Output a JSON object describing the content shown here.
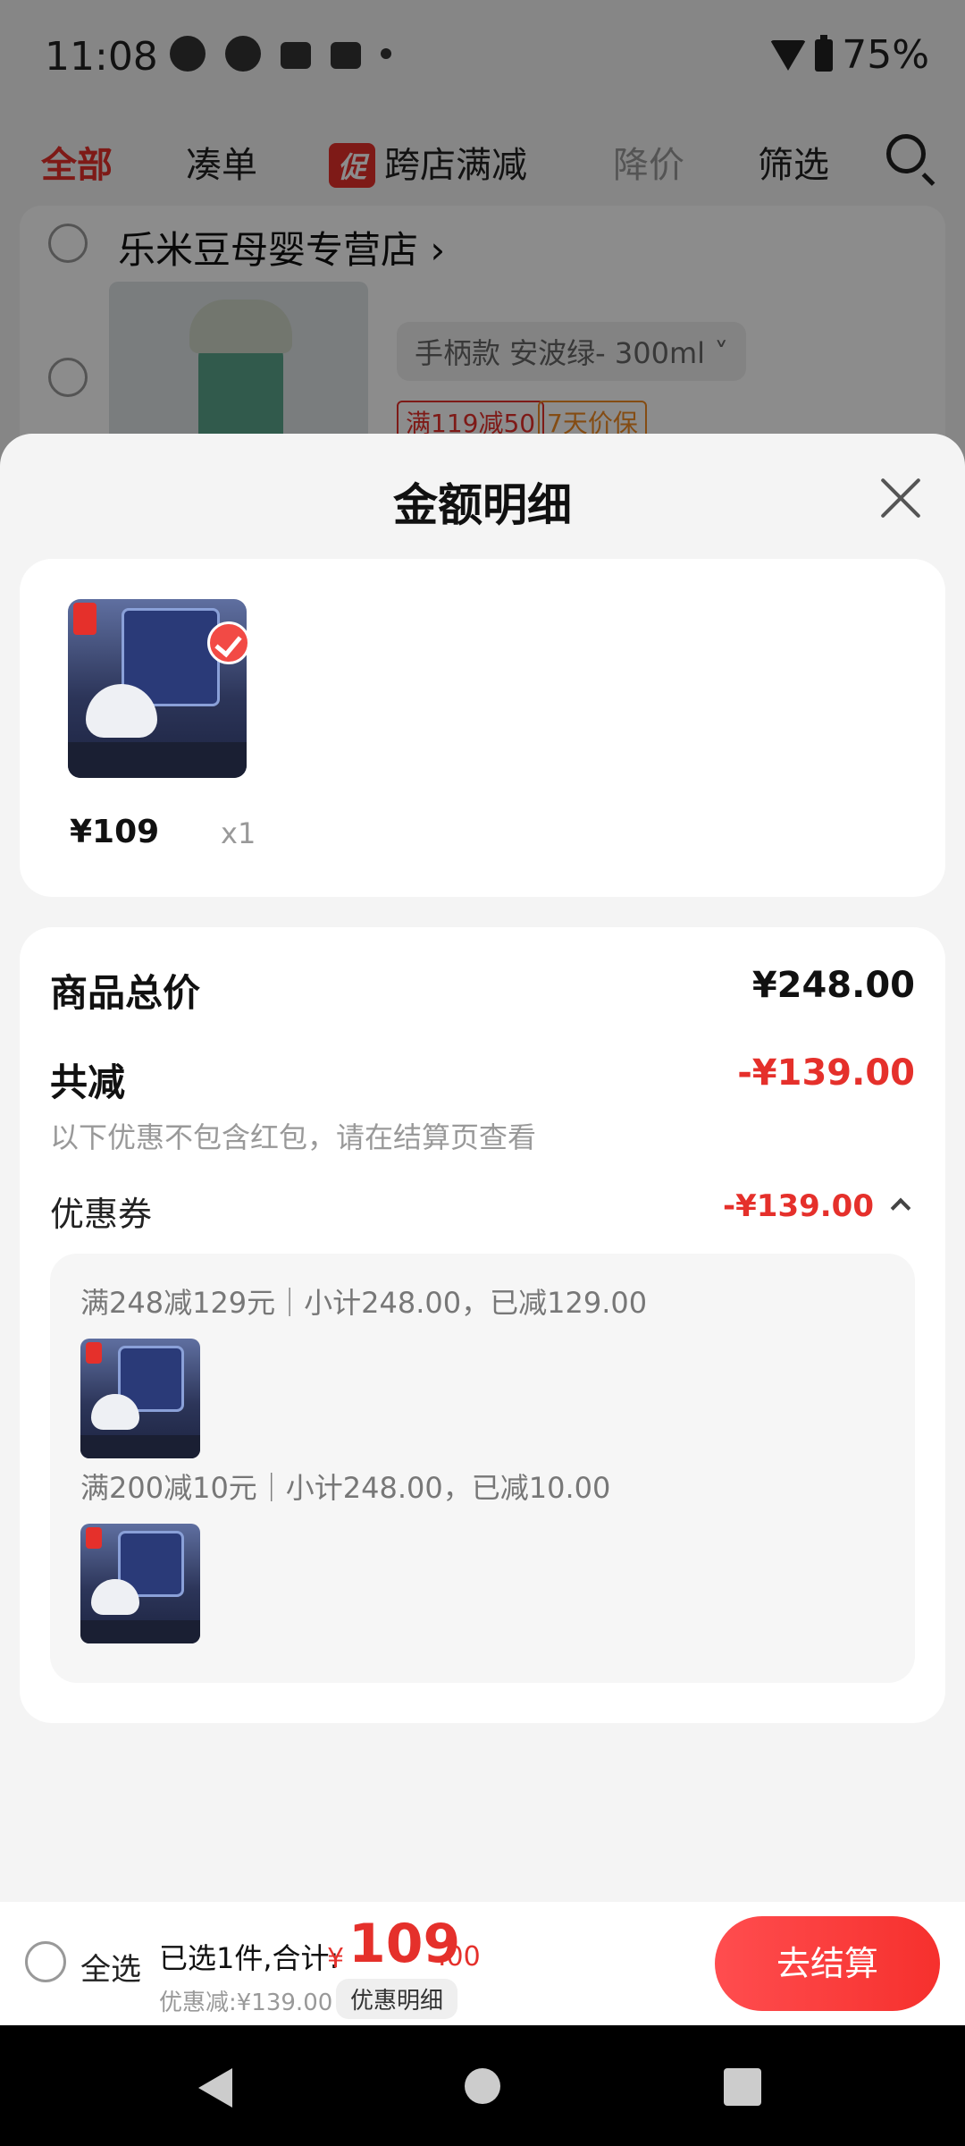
{
  "status_bar": {
    "time": "11:08",
    "battery": "75%"
  },
  "filter_tabs": {
    "all": "全部",
    "bundle": "凑单",
    "promo_badge": "促",
    "cross_store": "跨店满减",
    "price_drop": "降价",
    "filter": "筛选"
  },
  "store": {
    "name": "乐米豆母婴专营店",
    "variant": "手柄款 安波绿- 300ml",
    "tags": [
      "满119减50",
      "7天价保"
    ]
  },
  "sheet": {
    "title": "金额明细",
    "items": [
      {
        "price": "¥109",
        "qty": "x1"
      }
    ],
    "summary": {
      "subtotal_label": "商品总价",
      "subtotal_value": "¥248.00",
      "discount_label": "共减",
      "discount_value": "-¥139.00",
      "note": "以下优惠不包含红包，请在结算页查看",
      "coupon_label": "优惠券",
      "coupon_value": "-¥139.00",
      "coupons": [
        {
          "text": "满248减129元｜小计248.00，已减129.00"
        },
        {
          "text": "满200减10元｜小计248.00，已减10.00"
        }
      ]
    }
  },
  "bottom_bar": {
    "select_all": "全选",
    "selected_text": "已选1件,合计:",
    "currency": "¥",
    "total_int": "109",
    "total_dec": ".00",
    "discount_text": "优惠减:¥139.00",
    "detail_button": "优惠明细",
    "checkout_button": "去结算"
  },
  "colors": {
    "accent": "#e5302b",
    "muted": "#999999"
  }
}
